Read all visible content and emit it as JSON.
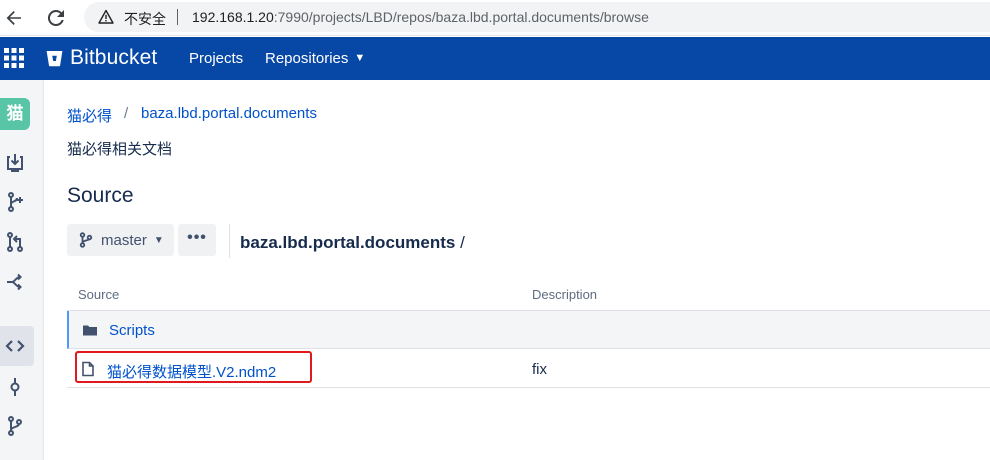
{
  "browser": {
    "security_label": "不安全",
    "url_host": "192.168.1.20",
    "url_rest": ":7990/projects/LBD/repos/baza.lbd.portal.documents/browse",
    "icons": {
      "back": "arrow-left-icon",
      "reload": "reload-icon",
      "warning": "warning-triangle-icon"
    }
  },
  "header": {
    "brand": "Bitbucket",
    "nav": {
      "projects": "Projects",
      "repositories": "Repositories"
    },
    "colors": {
      "background": "#0747a6",
      "text": "#ffffff"
    }
  },
  "sidebar": {
    "avatar_text": "猫",
    "avatar_color": "#57c5a6",
    "items": [
      {
        "icon": "clone-download-icon"
      },
      {
        "icon": "create-branch-icon"
      },
      {
        "icon": "pull-request-icon"
      },
      {
        "icon": "fork-icon"
      },
      {
        "icon": "source-code-icon",
        "active": true
      },
      {
        "icon": "commit-icon"
      },
      {
        "icon": "branches-icon"
      }
    ]
  },
  "breadcrumb": {
    "project": "猫必得",
    "separator": "/",
    "repository": "baza.lbd.portal.documents"
  },
  "repo_description": "猫必得相关文档",
  "page_title": "Source",
  "toolbar": {
    "branch": "master",
    "more_label": "•••",
    "path_repo": "baza.lbd.portal.documents",
    "path_sep": " /"
  },
  "table": {
    "columns": {
      "source": "Source",
      "description": "Description"
    },
    "rows": [
      {
        "type": "folder",
        "name": "Scripts",
        "description": ""
      },
      {
        "type": "file",
        "name": "猫必得数据模型.V2.ndm2",
        "description": "fix",
        "highlighted": true
      }
    ]
  },
  "colors": {
    "link": "#0052cc",
    "highlight_border": "#e0191e"
  }
}
